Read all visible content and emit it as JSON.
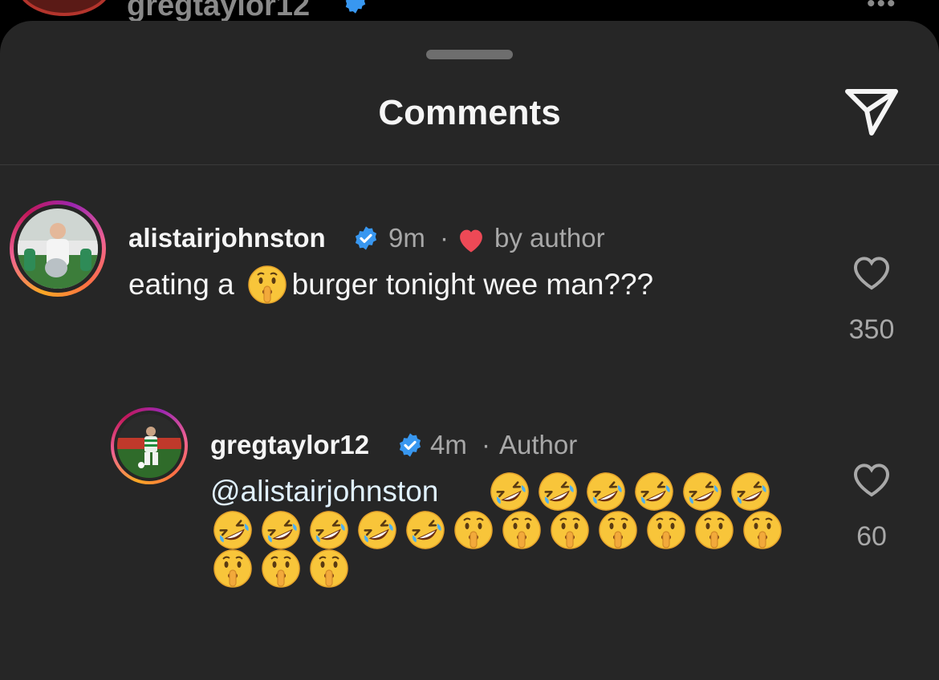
{
  "background_post": {
    "username": "gregtaylor12"
  },
  "sheet": {
    "title": "Comments",
    "share_icon": "paper-plane-icon"
  },
  "comments": [
    {
      "username": "alistairjohnston",
      "verified": true,
      "time": "9m",
      "separator": "·",
      "liked_by_author_label": "by author",
      "text_before_emoji": "eating a",
      "text_after_emoji": "burger tonight wee man???",
      "inline_emoji": "shushing-face-emoji",
      "likes": "350"
    },
    {
      "username": "gregtaylor12",
      "verified": true,
      "time": "4m",
      "separator": "·",
      "author_label": "Author",
      "mention": "@alistairjohnston",
      "emojis": [
        "rofl",
        "rofl",
        "rofl",
        "rofl",
        "rofl",
        "rofl",
        "rofl",
        "rofl",
        "rofl",
        "rofl",
        "rofl",
        "shush",
        "shush",
        "shush",
        "shush",
        "shush",
        "shush",
        "shush",
        "shush",
        "shush",
        "shush"
      ],
      "likes": "60"
    }
  ],
  "colors": {
    "sheet_bg": "#262626",
    "verified_blue": "#3897f0",
    "heart_red": "#ed4956",
    "muted_text": "#a8a8a8"
  }
}
